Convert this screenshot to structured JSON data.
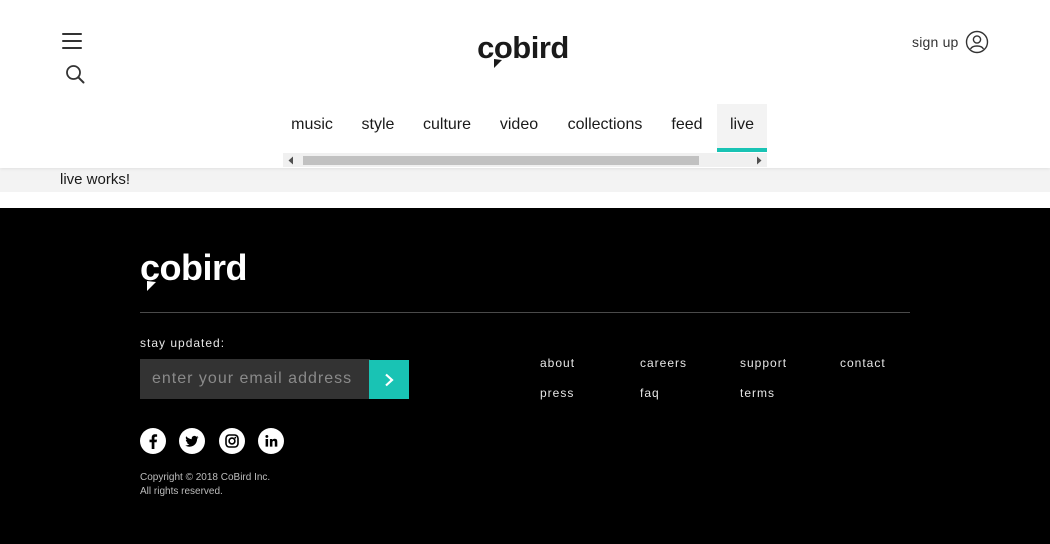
{
  "header": {
    "logo_text": "cobird",
    "signup_label": "sign up",
    "nav": [
      {
        "label": "music",
        "active": false
      },
      {
        "label": "style",
        "active": false
      },
      {
        "label": "culture",
        "active": false
      },
      {
        "label": "video",
        "active": false
      },
      {
        "label": "collections",
        "active": false
      },
      {
        "label": "feed",
        "active": false
      },
      {
        "label": "live",
        "active": true
      }
    ]
  },
  "content": {
    "text": "live works!"
  },
  "footer": {
    "logo_text": "cobird",
    "stay_updated_label": "stay updated:",
    "email_placeholder": "enter your email address",
    "links": [
      {
        "label": "about"
      },
      {
        "label": "careers"
      },
      {
        "label": "support"
      },
      {
        "label": "contact"
      },
      {
        "label": "press"
      },
      {
        "label": "faq"
      },
      {
        "label": "terms"
      }
    ],
    "socials": [
      "facebook-icon",
      "twitter-icon",
      "instagram-icon",
      "linkedin-icon"
    ],
    "copyright_line1": "Copyright © 2018 CoBird Inc.",
    "copyright_line2": "All rights reserved."
  },
  "colors": {
    "accent": "#19c3b4",
    "footer_bg": "#000000",
    "content_bg": "#f3f3f3"
  }
}
